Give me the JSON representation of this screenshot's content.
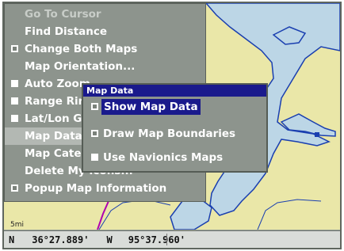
{
  "menu": {
    "items": [
      {
        "label": "Go To Cursor",
        "checkbox": false,
        "checked": false,
        "state": "disabled"
      },
      {
        "label": "Find Distance",
        "checkbox": false,
        "checked": false,
        "state": "normal"
      },
      {
        "label": "Change Both Maps",
        "checkbox": true,
        "checked": true,
        "state": "normal"
      },
      {
        "label": "Map Orientation...",
        "checkbox": false,
        "checked": false,
        "state": "normal"
      },
      {
        "label": "Auto Zoom",
        "checkbox": true,
        "checked": false,
        "state": "normal"
      },
      {
        "label": "Range Rings",
        "checkbox": true,
        "checked": false,
        "state": "normal"
      },
      {
        "label": "Lat/Lon Grid",
        "checkbox": true,
        "checked": false,
        "state": "normal"
      },
      {
        "label": "Map Data",
        "checkbox": false,
        "checked": false,
        "state": "highlight"
      },
      {
        "label": "Map Categories Drawn...",
        "checkbox": false,
        "checked": false,
        "state": "normal"
      },
      {
        "label": "Delete My Icons...",
        "checkbox": false,
        "checked": false,
        "state": "normal"
      },
      {
        "label": "Popup Map Information",
        "checkbox": true,
        "checked": true,
        "state": "normal"
      }
    ]
  },
  "submenu": {
    "title": "Map Data",
    "items": [
      {
        "label": "Show Map Data",
        "checked": true,
        "selected": true
      },
      {
        "label": "Draw Map Boundaries",
        "checked": true,
        "selected": false
      },
      {
        "label": "Use Navionics Maps",
        "checked": false,
        "selected": false
      }
    ]
  },
  "map": {
    "scale_label": "5mi",
    "colors": {
      "land": "#eae7a8",
      "water": "#bcd6e6",
      "coast": "#1a3fb0",
      "route": "#b000b0"
    }
  },
  "status_bar": {
    "lat_dir": "N",
    "lat_value": "36°27.889'",
    "lon_dir": "W",
    "lon_value": "95°37.960'"
  }
}
